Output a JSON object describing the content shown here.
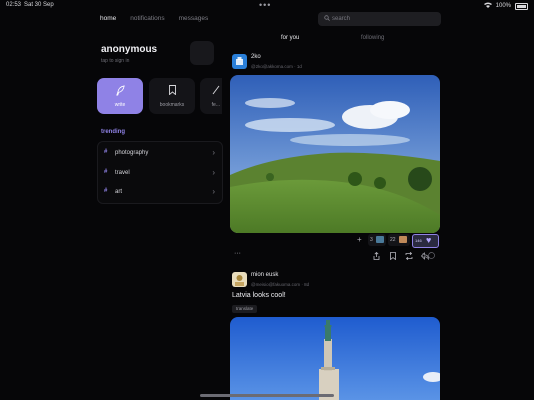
{
  "status": {
    "time": "02:53",
    "date": "Sat 30 Sep",
    "battery": "100%"
  },
  "nav": {
    "home": "home",
    "notifications": "notifications",
    "messages": "messages"
  },
  "search": {
    "placeholder": "search"
  },
  "profile": {
    "name": "anonymous",
    "subtitle": "tap to sign in"
  },
  "actions": {
    "write": "write",
    "bookmarks": "bookmarks",
    "more": "fe..."
  },
  "trending": {
    "label": "trending",
    "items": [
      "photography",
      "travel",
      "art"
    ]
  },
  "feed": {
    "tabs": {
      "for_you": "for you",
      "following": "following"
    },
    "posts": [
      {
        "name": "2ko",
        "handle": "@2ko@akkoma.com",
        "age": "1d",
        "reactions": {
          "count1": "3",
          "count2": "22",
          "count3": "146"
        },
        "reply_count": "0"
      },
      {
        "name": "mion eusk",
        "handle": "@meisio@fakuoma.com",
        "age": "8d",
        "text": "Latvia looks cool!",
        "tag": "translate"
      }
    ]
  },
  "colors": {
    "accent": "#8f82e6",
    "background": "#060608"
  }
}
